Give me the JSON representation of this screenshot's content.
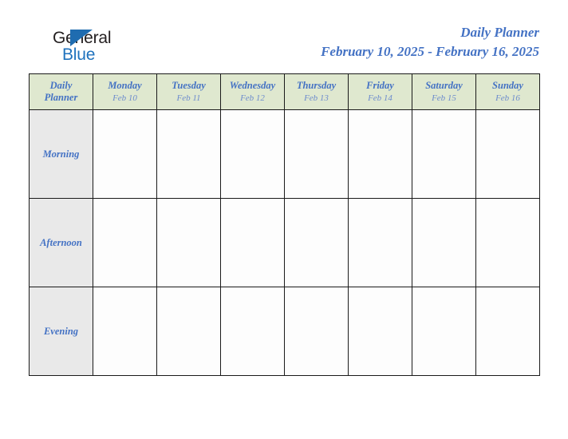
{
  "brand": {
    "word_top": "General",
    "word_bottom": "Blue",
    "triangle_icon": "triangle-icon",
    "color_dark": "#231f20",
    "color_blue": "#1f72bd"
  },
  "header": {
    "title": "Daily Planner",
    "date_range": "February 10, 2025 - February 16, 2025",
    "title_color": "#4472c4"
  },
  "table": {
    "corner_label_line1": "Daily",
    "corner_label_line2": "Planner",
    "header_bg": "#dfe8cf",
    "label_bg": "#e9e9e9",
    "cell_bg": "#fdfdfd",
    "border_color": "#1a1a1a",
    "days": [
      {
        "name": "Monday",
        "date": "Feb 10"
      },
      {
        "name": "Tuesday",
        "date": "Feb 11"
      },
      {
        "name": "Wednesday",
        "date": "Feb 12"
      },
      {
        "name": "Thursday",
        "date": "Feb 13"
      },
      {
        "name": "Friday",
        "date": "Feb 14"
      },
      {
        "name": "Saturday",
        "date": "Feb 15"
      },
      {
        "name": "Sunday",
        "date": "Feb 16"
      }
    ],
    "periods": [
      {
        "label": "Morning",
        "entries": [
          "",
          "",
          "",
          "",
          "",
          "",
          ""
        ]
      },
      {
        "label": "Afternoon",
        "entries": [
          "",
          "",
          "",
          "",
          "",
          "",
          ""
        ]
      },
      {
        "label": "Evening",
        "entries": [
          "",
          "",
          "",
          "",
          "",
          "",
          ""
        ]
      }
    ]
  }
}
